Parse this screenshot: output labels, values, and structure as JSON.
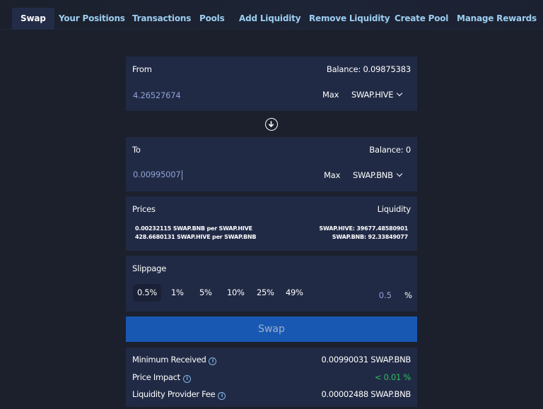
{
  "nav": {
    "items": [
      {
        "label": "Swap",
        "active": true
      },
      {
        "label": "Your Positions"
      },
      {
        "label": "Transactions"
      },
      {
        "label": "Pools"
      },
      {
        "label": "Add Liquidity"
      },
      {
        "label": "Remove Liquidity"
      },
      {
        "label": "Create Pool"
      },
      {
        "label": "Manage Rewards"
      }
    ]
  },
  "from": {
    "label": "From",
    "balance": "Balance: 0.09875383",
    "amount": "4.26527674",
    "max_label": "Max",
    "token": "SWAP.HIVE"
  },
  "swap_direction_icon": "arrow-down-circle-icon",
  "to": {
    "label": "To",
    "balance": "Balance: 0",
    "amount": "0.00995007",
    "max_label": "Max",
    "token": "SWAP.BNB"
  },
  "prices": {
    "title": "Prices",
    "lines": [
      "0.00232115 SWAP.BNB per SWAP.HIVE",
      "428.6680131 SWAP.HIVE per SWAP.BNB"
    ],
    "liquidity_title": "Liquidity",
    "liquidity_lines": [
      "SWAP.HIVE: 39677.48580901",
      "SWAP.BNB: 92.33849077"
    ]
  },
  "slippage": {
    "title": "Slippage",
    "options": [
      "0.5%",
      "1%",
      "5%",
      "10%",
      "25%",
      "49%"
    ],
    "selected": "0.5%",
    "custom_value": "0.5",
    "unit": "%"
  },
  "swap_button": "Swap",
  "details": {
    "rows": [
      {
        "label": "Minimum Received",
        "value": "0.00990031 SWAP.BNB"
      },
      {
        "label": "Price Impact",
        "value": "< 0.01 %"
      },
      {
        "label": "Liquidity Provider Fee",
        "value": "0.00002488 SWAP.BNB"
      }
    ],
    "info_icon_glyph": "i"
  },
  "colors": {
    "background": "#1b202c",
    "panel": "#212a45",
    "nav_link": "#9ccdf0",
    "accent_button": "#1958b2",
    "positive": "#2fbf5a",
    "input_text": "#8fa3d6"
  }
}
